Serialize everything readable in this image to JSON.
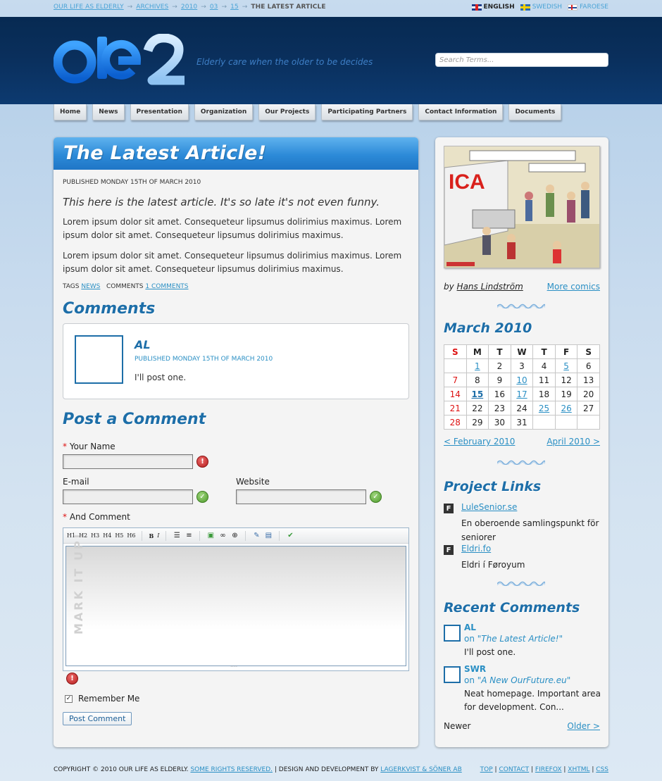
{
  "breadcrumb": {
    "items": [
      "OUR LIFE AS ELDERLY",
      "ARCHIVES",
      "2010",
      "03",
      "15"
    ],
    "separator": "→",
    "current": "THE LATEST ARTICLE"
  },
  "languages": [
    {
      "label": "ENGLISH",
      "flag": "uk-flag-icon",
      "active": true
    },
    {
      "label": "SWEDISH",
      "flag": "sweden-flag-icon",
      "active": false
    },
    {
      "label": "FAROESE",
      "flag": "faroe-flag-icon",
      "active": false
    }
  ],
  "header": {
    "logo_text": "Ole2",
    "tagline": "Elderly care when the older to be decides",
    "search_placeholder": "Search Terms..."
  },
  "nav": [
    "Home",
    "News",
    "Presentation",
    "Organization",
    "Our Projects",
    "Participating Partners",
    "Contact Information",
    "Documents"
  ],
  "article": {
    "title": "The Latest Article!",
    "published": "PUBLISHED MONDAY 15TH OF MARCH 2010",
    "lead": "This here is the latest article. It's so late it's not even funny.",
    "paragraphs": [
      "Lorem ipsum dolor sit amet. Consequeteur lipsumus dolirimius maximus. Lorem ipsum dolor sit amet. Consequeteur lipsumus dolirimius maximus.",
      "Lorem ipsum dolor sit amet. Consequeteur lipsumus dolirimius maximus. Lorem ipsum dolor sit amet. Consequeteur lipsumus dolirimius maximus."
    ],
    "tags_label": "TAGS",
    "tag": "NEWS",
    "comments_label": "COMMENTS",
    "comments_link": "1 COMMENTS"
  },
  "comments": {
    "heading": "Comments",
    "items": [
      {
        "name": "AL",
        "date": "PUBLISHED MONDAY 15TH OF MARCH 2010",
        "text": "I'll post one."
      }
    ]
  },
  "form": {
    "heading": "Post a Comment",
    "required_mark": "*",
    "name_label": "Your Name",
    "email_label": "E-mail",
    "website_label": "Website",
    "comment_label": "And Comment",
    "toolbar": [
      "H1",
      "H2",
      "H3",
      "H4",
      "H5",
      "H6",
      "B",
      "I"
    ],
    "watermark": "MARK IT UP!",
    "remember_label": "Remember Me",
    "remember_checked": true,
    "submit_label": "Post Comment"
  },
  "sidebar": {
    "comic_by": "by",
    "comic_author": "Hans Lindström",
    "more_comics": "More comics",
    "calendar": {
      "title": "March 2010",
      "weekdays": [
        "S",
        "M",
        "T",
        "W",
        "T",
        "F",
        "S"
      ],
      "weeks": [
        [
          "",
          "1",
          "2",
          "3",
          "4",
          "5",
          "6"
        ],
        [
          "7",
          "8",
          "9",
          "10",
          "11",
          "12",
          "13"
        ],
        [
          "14",
          "15",
          "16",
          "17",
          "18",
          "19",
          "20"
        ],
        [
          "21",
          "22",
          "23",
          "24",
          "25",
          "26",
          "27"
        ],
        [
          "28",
          "29",
          "30",
          "31",
          "",
          "",
          ""
        ]
      ],
      "linked_days": [
        "1",
        "5",
        "10",
        "15",
        "17",
        "25",
        "26"
      ],
      "today": "15",
      "prev": "< February 2010",
      "next": "April 2010 >"
    },
    "project_links": {
      "heading": "Project Links",
      "items": [
        {
          "name": "LuleSenior.se",
          "desc": "En oberoende samlingspunkt för seniorer"
        },
        {
          "name": "Eldri.fo",
          "desc": "Eldri í Føroyum"
        }
      ]
    },
    "recent_comments": {
      "heading": "Recent Comments",
      "items": [
        {
          "name": "AL",
          "on": "on \"",
          "article": "The Latest Article!",
          "close": "\"",
          "text": "I'll post one."
        },
        {
          "name": "SWR",
          "on": "on \"",
          "article": "A New OurFuture.eu",
          "close": "\"",
          "text": "Neat homepage. Important area for development. Con..."
        }
      ],
      "newer": "Newer",
      "older": "Older >"
    }
  },
  "footer": {
    "copyright": "COPYRIGHT © 2010 OUR LIFE AS ELDERLY.",
    "rights_link": "SOME RIGHTS RESERVED.",
    "design": "| DESIGN AND DEVELOPMENT BY",
    "designer_link": "LAGERKVIST & SÖNER AB",
    "links": [
      "TOP",
      "CONTACT",
      "FIREFOX",
      "XHTML",
      "CSS"
    ]
  },
  "colors": {
    "brand_dark": "#0a2f5c",
    "accent": "#2a8fc4",
    "heading": "#1d6ea8",
    "error": "#c62828",
    "ok": "#4e9b2c"
  }
}
